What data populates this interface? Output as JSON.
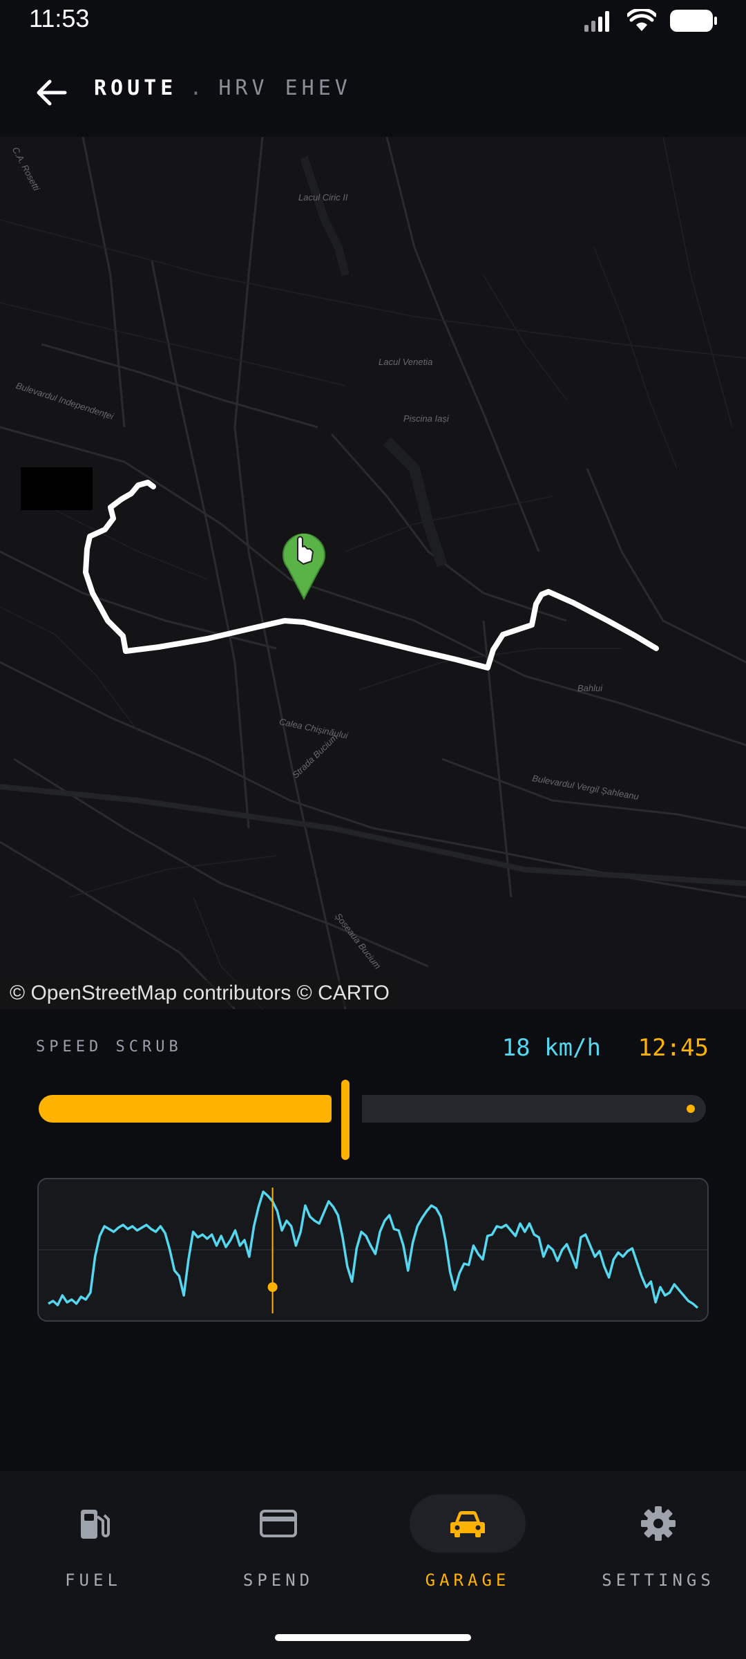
{
  "status": {
    "time": "11:53"
  },
  "header": {
    "title": "ROUTE",
    "separator": ".",
    "subtitle": "HRV EHEV"
  },
  "map": {
    "attribution": "© OpenStreetMap contributors © CARTO",
    "labels": [
      "C.A. Rosetti",
      "Lacul Ciric II",
      "Lacul Venetia",
      "Piscina Iași",
      "Bulevardul Independenței",
      "Calea Chișinăului",
      "Strada Bucium",
      "Bulevardul Vergil Șahleanu",
      "Bahlui",
      "Șoseaua Bucium"
    ]
  },
  "scrub": {
    "label": "SPEED SCRUB",
    "speed": "18 km/h",
    "time": "12:45",
    "progress": 0.46,
    "sparkline": [
      6,
      8,
      5,
      12,
      7,
      9,
      6,
      11,
      9,
      14,
      40,
      55,
      62,
      60,
      58,
      61,
      63,
      60,
      62,
      59,
      61,
      63,
      60,
      58,
      62,
      57,
      45,
      30,
      26,
      12,
      38,
      58,
      54,
      56,
      53,
      56,
      48,
      55,
      47,
      52,
      59,
      48,
      52,
      40,
      62,
      76,
      87,
      84,
      80,
      73,
      59,
      66,
      62,
      48,
      58,
      77,
      69,
      66,
      64,
      72,
      80,
      76,
      70,
      54,
      33,
      22,
      46,
      58,
      55,
      48,
      42,
      58,
      66,
      70,
      60,
      59,
      48,
      30,
      50,
      62,
      68,
      73,
      77,
      75,
      69,
      52,
      29,
      16,
      28,
      35,
      34,
      48,
      42,
      38,
      55,
      56,
      62,
      61,
      63,
      59,
      55,
      64,
      58,
      64,
      56,
      54,
      40,
      48,
      45,
      37,
      45,
      49,
      41,
      32,
      54,
      56,
      48,
      40,
      44,
      33,
      25,
      38,
      43,
      40,
      44,
      46,
      36,
      26,
      18,
      22,
      7,
      18,
      12,
      14,
      20,
      16,
      12,
      8,
      6,
      3
    ],
    "cursor_index": 48,
    "cursor_value": 18
  },
  "nav": {
    "active": 2,
    "items": [
      {
        "label": "FUEL",
        "icon": "fuel-pump-icon"
      },
      {
        "label": "SPEND",
        "icon": "credit-card-icon"
      },
      {
        "label": "GARAGE",
        "icon": "car-icon"
      },
      {
        "label": "SETTINGS",
        "icon": "gear-icon"
      }
    ]
  },
  "colors": {
    "accent": "#ffb300",
    "speed": "#55d7ef",
    "route": "#ffffff",
    "marker": "#5ab347"
  }
}
